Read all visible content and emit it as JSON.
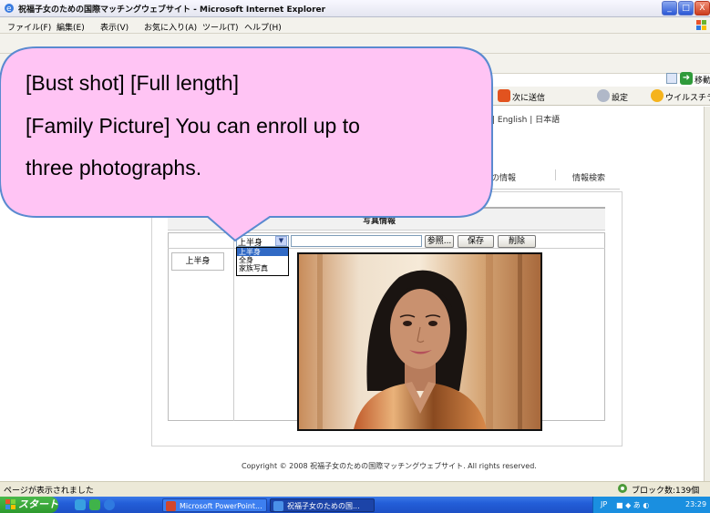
{
  "window": {
    "title": "祝福子女のための国際マッチングウェブサイト - Microsoft Internet Explorer",
    "buttons": [
      "_",
      "□",
      "X"
    ]
  },
  "menu": [
    "ファイル(F)",
    "編集(E)",
    "表示(V)",
    "お気に入り(A)",
    "ツール(T)",
    "ヘルプ(H)"
  ],
  "address": {
    "go_label": "移動"
  },
  "links_bar": {
    "send_label": "次に送信",
    "settings_label": "設定",
    "virus_label": "ウイルスチラ"
  },
  "page": {
    "languages": "| English | 日本語",
    "tab_partial": "での情報",
    "tab_search": "情報検索",
    "photo_section_title": "写真情報",
    "row_label": "上半身",
    "select_value": "上半身",
    "select_options": [
      "上半身",
      "全身",
      "家族写真"
    ],
    "browse_button": "参照...",
    "save_button": "保存",
    "delete_button": "削除",
    "copyright": "Copyright © 2008 祝福子女のための国際マッチングウェブサイト. All rights reserved."
  },
  "callout": {
    "lines": [
      "[Bust shot] [Full length]",
      "[Family Picture] You can enroll up to",
      "three photographs."
    ],
    "fill": "#ffc4f4",
    "stroke": "#5a8ad0"
  },
  "status": {
    "text": "ページが表示されました",
    "blocked": "ブロック数:139個"
  },
  "taskbar": {
    "start": "スタート",
    "tasks": [
      "Microsoft PowerPoint...",
      "祝福子女のための国..."
    ],
    "tray_lang": "JP",
    "clock": "23:29"
  }
}
